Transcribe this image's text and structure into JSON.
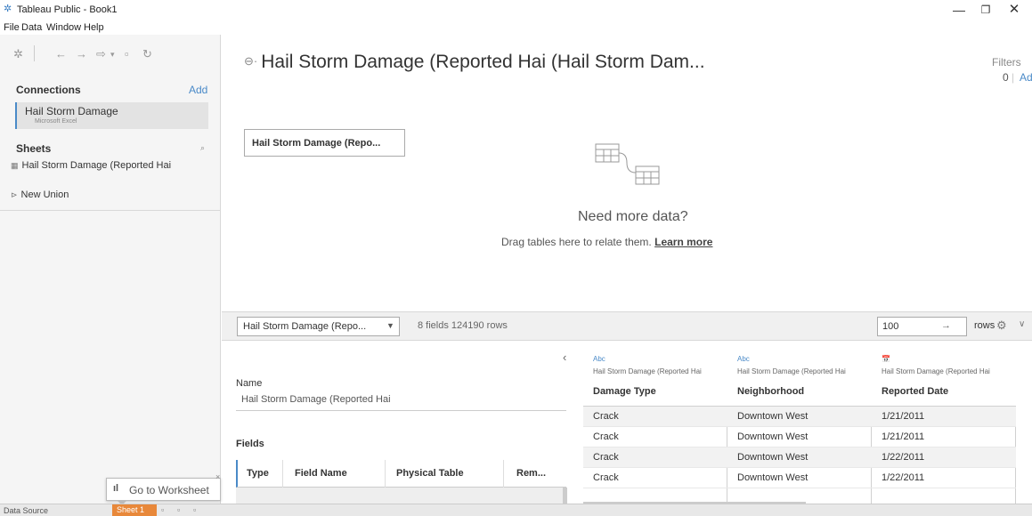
{
  "window": {
    "title": "Tableau Public - Book1",
    "minimize_icon": "—",
    "maximize_icon": "❐",
    "close_icon": "✕"
  },
  "menu": [
    "File",
    "Data",
    "Window",
    "Help"
  ],
  "left": {
    "connections_title": "Connections",
    "add_label": "Add",
    "connection": {
      "name": "Hail Storm Damage",
      "type": "Microsoft Excel"
    },
    "sheets_title": "Sheets",
    "sheets": [
      {
        "icon": "▦",
        "label": "Hail Storm Damage (Reported Hai"
      },
      {
        "icon": "⊳",
        "label": "New Union"
      }
    ]
  },
  "canvas": {
    "title": "Hail Storm Damage (Reported Hai (Hail Storm Dam...",
    "filters_label": "Filters",
    "filters_count": "0",
    "filters_add": "Add",
    "table_pill": "Hail Storm Damage (Repo...",
    "need_more": "Need more data?",
    "drag_text": "Drag tables here to relate them.",
    "learn_more": "Learn more"
  },
  "gridbar": {
    "table_select": "Hail Storm Damage (Repo...",
    "fields_info": "8 fields 124190 rows",
    "rows_value": "100",
    "rows_label": "rows"
  },
  "meta": {
    "name_label": "Name",
    "name_value": "Hail Storm Damage (Reported Hai",
    "fields_label": "Fields",
    "columns": [
      "Type",
      "Field Name",
      "Physical Table",
      "Rem..."
    ]
  },
  "grid": {
    "columns": [
      {
        "type": "Abc",
        "source": "Hail Storm Damage (Reported Hai",
        "name": "Damage Type",
        "values": [
          "Crack",
          "Crack",
          "Crack",
          "Crack"
        ]
      },
      {
        "type": "Abc",
        "source": "Hail Storm Damage (Reported Hai",
        "name": "Neighborhood",
        "values": [
          "Downtown West",
          "Downtown West",
          "Downtown West",
          "Downtown West"
        ]
      },
      {
        "type": "📅",
        "source": "Hail Storm Damage (Reported Hai",
        "name": "Reported Date",
        "values": [
          "1/21/2011",
          "1/21/2011",
          "1/22/2011",
          "1/22/2011"
        ]
      }
    ]
  },
  "tooltip": {
    "text": "Go to Worksheet"
  },
  "tabs": {
    "data_source": "Data Source",
    "sheet": "Sheet 1"
  },
  "colors": {
    "accent": "#4a8ac8",
    "sheet_tab": "#e8883a"
  }
}
